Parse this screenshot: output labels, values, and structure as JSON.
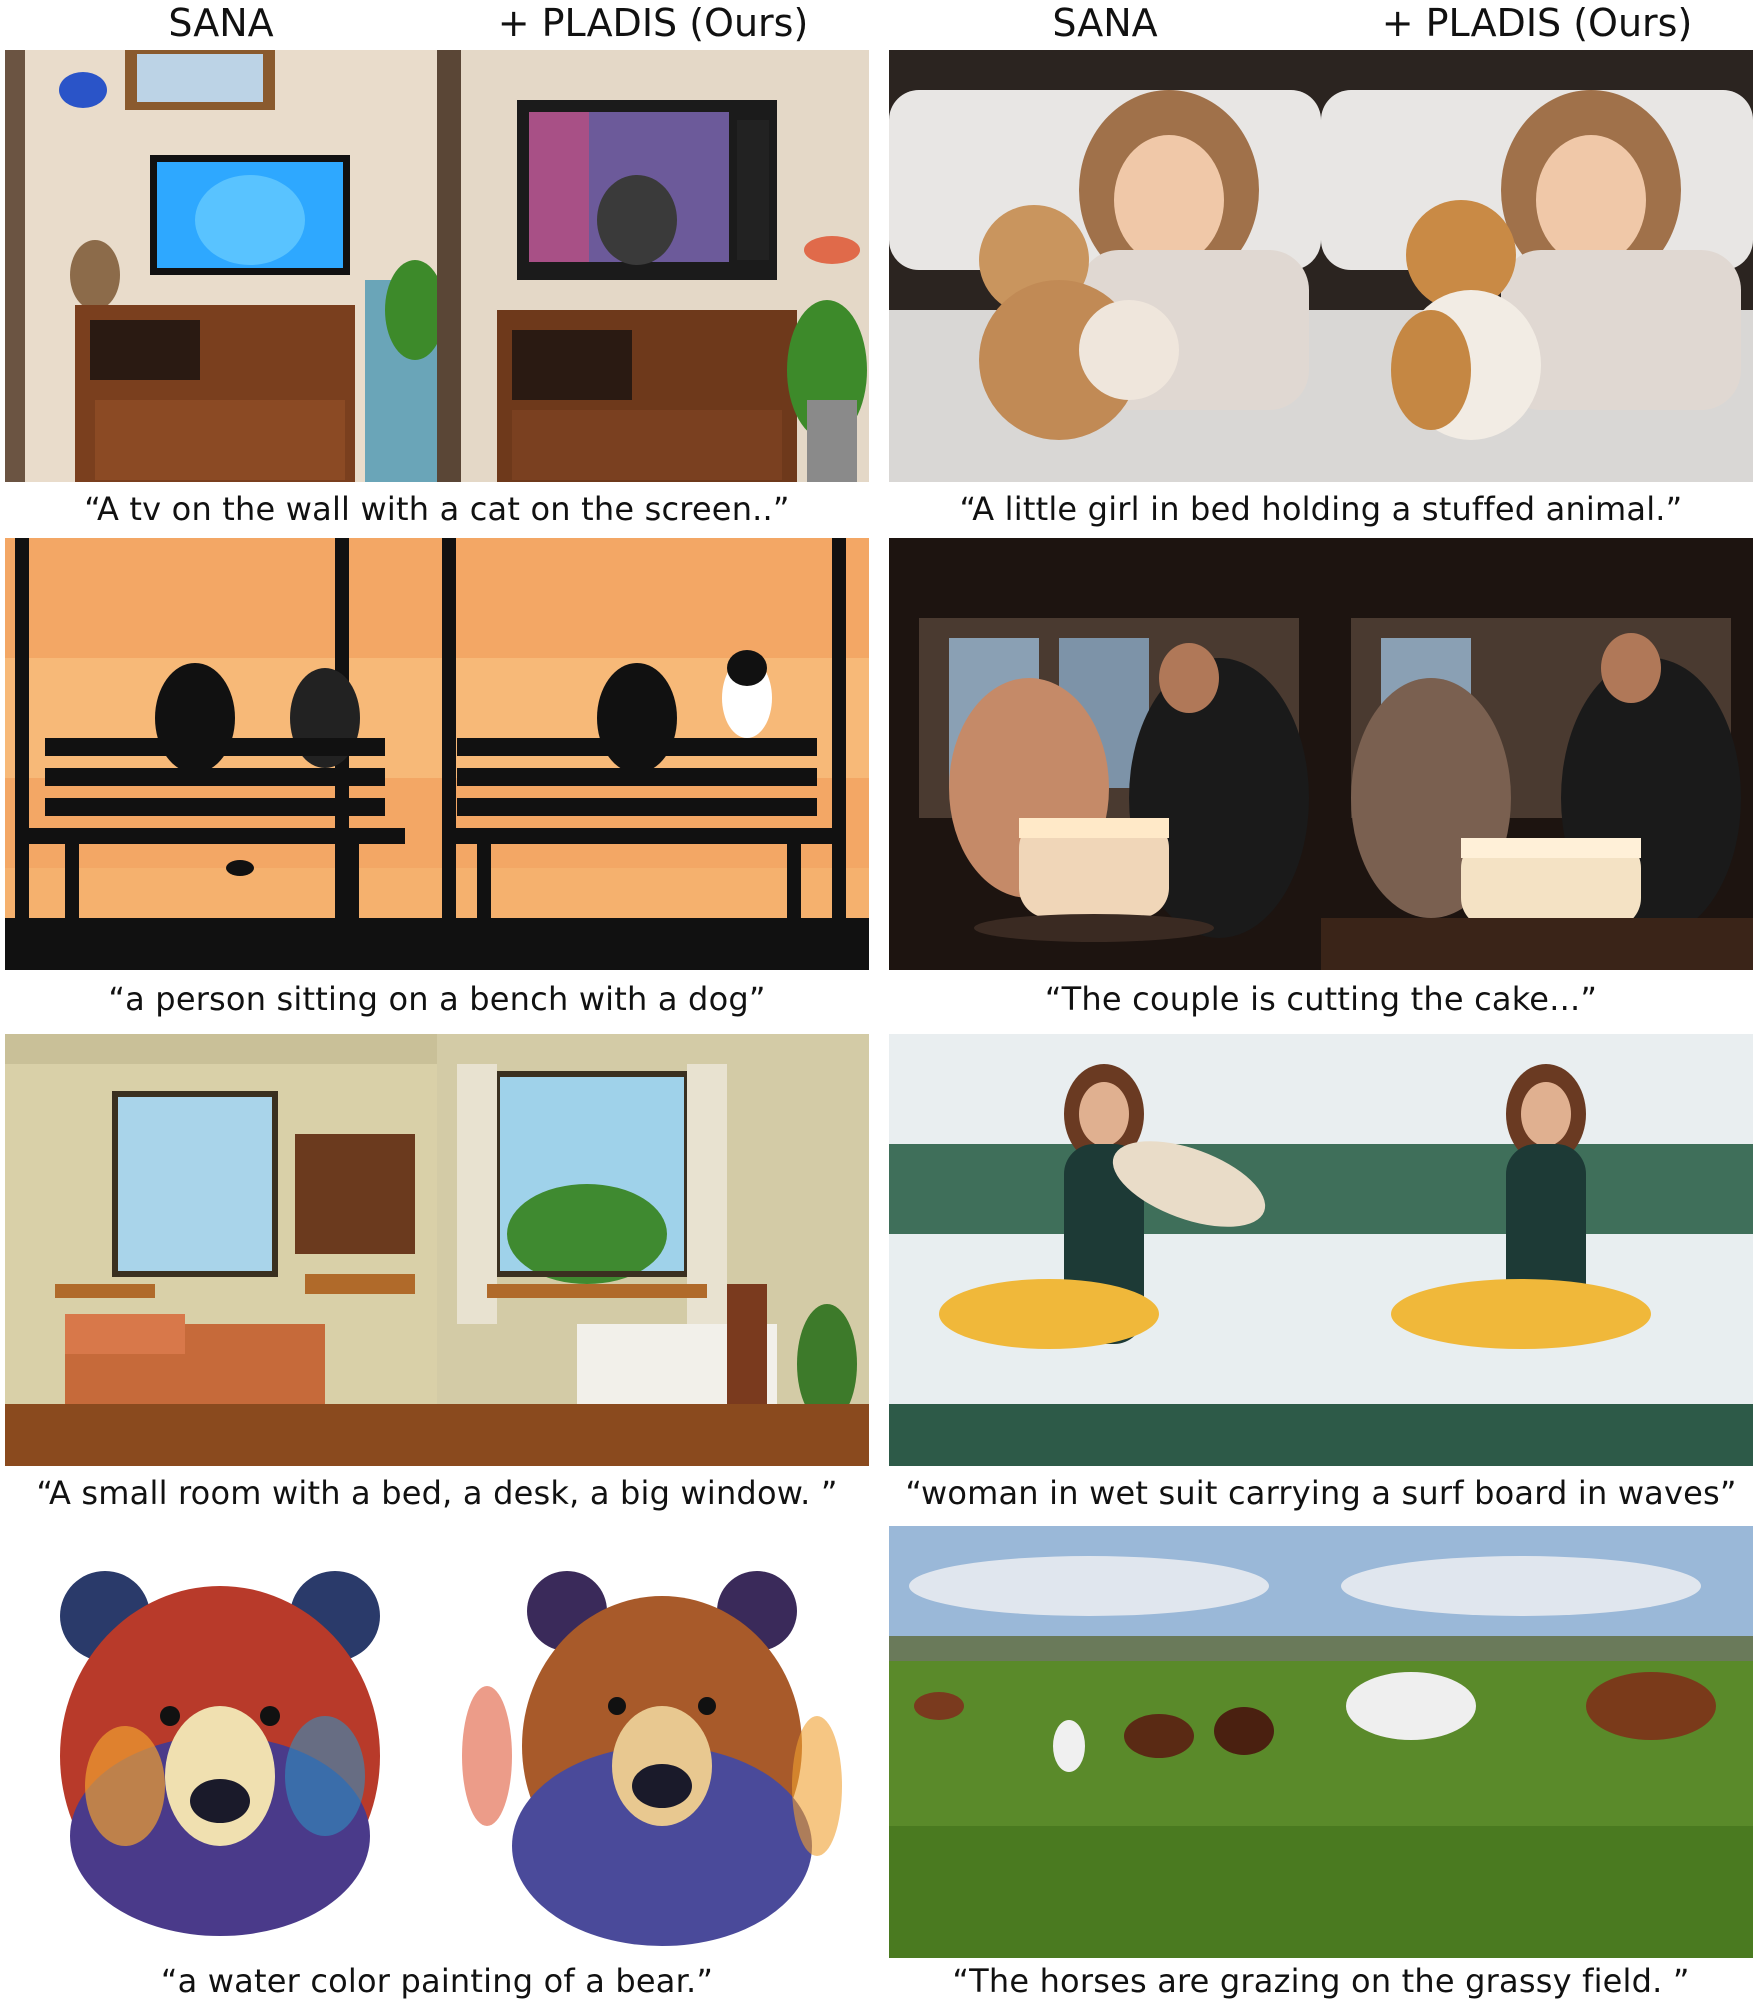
{
  "headers": {
    "left_sana": "SANA",
    "left_pladis": "+ PLADIS (Ours)",
    "right_sana": "SANA",
    "right_pladis": "+ PLADIS (Ours)"
  },
  "captions": [
    "“A tv on the wall with a cat on the screen..”",
    "“A little girl in bed holding a stuffed animal.”",
    "“a person sitting on a bench with a dog”",
    "“The couple is cutting the cake...”",
    "“A small room with a bed, a desk, a big window. ”",
    "“woman in wet suit carrying a surf board in waves”",
    "“a water color painting of a bear.”",
    "“The horses are grazing on the grassy field. ”"
  ]
}
